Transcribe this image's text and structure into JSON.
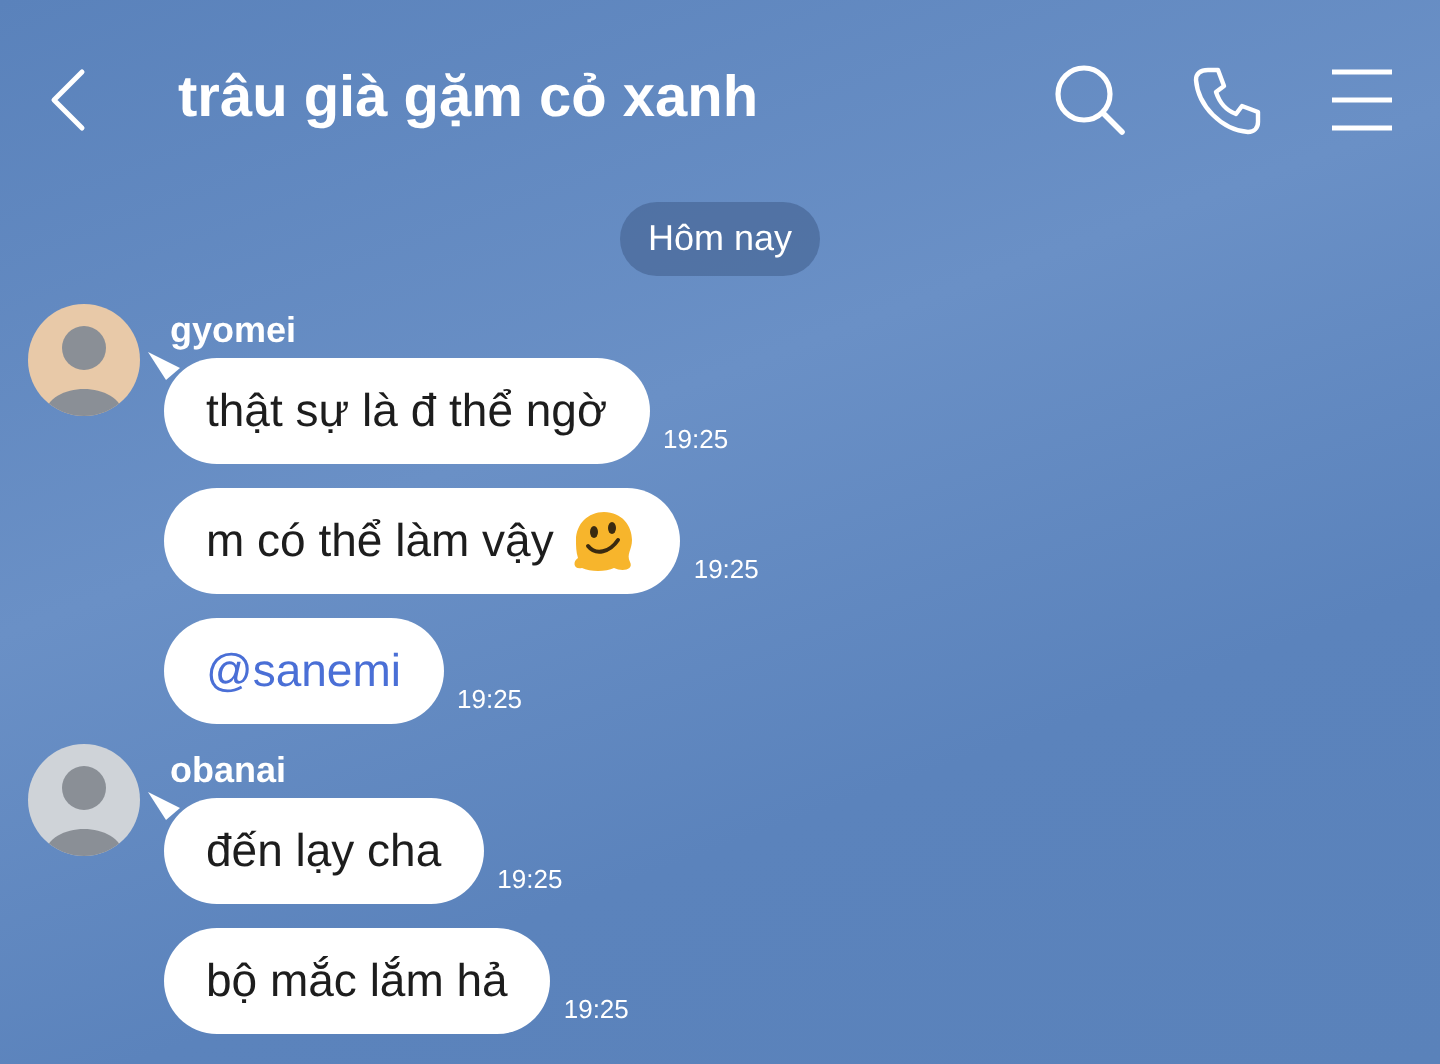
{
  "header": {
    "title": "trâu già gặm cỏ xanh"
  },
  "date_divider": "Hôm nay",
  "groups": [
    {
      "sender": "gyomei",
      "messages": [
        {
          "kind": "text",
          "text": "thật sự là đ thể ngờ",
          "time": "19:25",
          "has_emoji": false
        },
        {
          "kind": "text",
          "text": "m có thể làm vậy",
          "time": "19:25",
          "has_emoji": true
        },
        {
          "kind": "mention",
          "text": "@sanemi",
          "time": "19:25",
          "has_emoji": false
        }
      ]
    },
    {
      "sender": "obanai",
      "messages": [
        {
          "kind": "text",
          "text": "đến lạy cha",
          "time": "19:25",
          "has_emoji": false
        },
        {
          "kind": "text",
          "text": "bộ mắc lắm hả",
          "time": "19:25",
          "has_emoji": false
        }
      ]
    }
  ]
}
